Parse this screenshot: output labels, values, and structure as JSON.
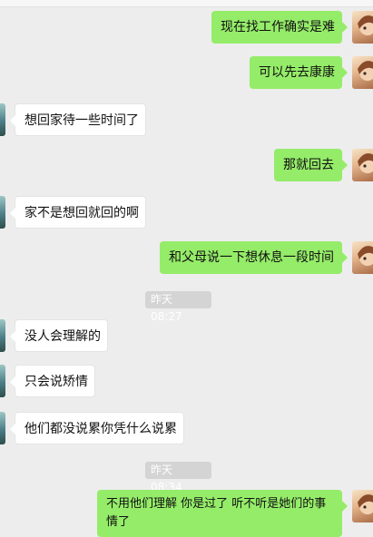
{
  "chat": {
    "messages": [
      {
        "side": "me",
        "text": "现在找工作确实是难"
      },
      {
        "side": "me",
        "text": "可以先去康康"
      },
      {
        "side": "them",
        "text": "想回家待一些时间了"
      },
      {
        "side": "me",
        "text": "那就回去"
      },
      {
        "side": "them",
        "text": "家不是想回就回的啊"
      },
      {
        "side": "me",
        "text": "和父母说一下想休息一段时间"
      },
      {
        "side": "them",
        "text": "没人会理解的"
      },
      {
        "side": "them",
        "text": "只会说矫情"
      },
      {
        "side": "them",
        "text": "他们都没说累你凭什么说累"
      },
      {
        "side": "me",
        "text": "不用他们理解  你是过了  听不听是她们的事情了"
      }
    ],
    "timestamps": [
      {
        "day": "昨天",
        "time": "08:27"
      },
      {
        "day": "昨天",
        "time": "08:34"
      }
    ]
  },
  "colors": {
    "background": "#ededed",
    "self_bubble": "#95ec69",
    "other_bubble": "#ffffff",
    "timestamp_bg": "#d4d4d4"
  }
}
